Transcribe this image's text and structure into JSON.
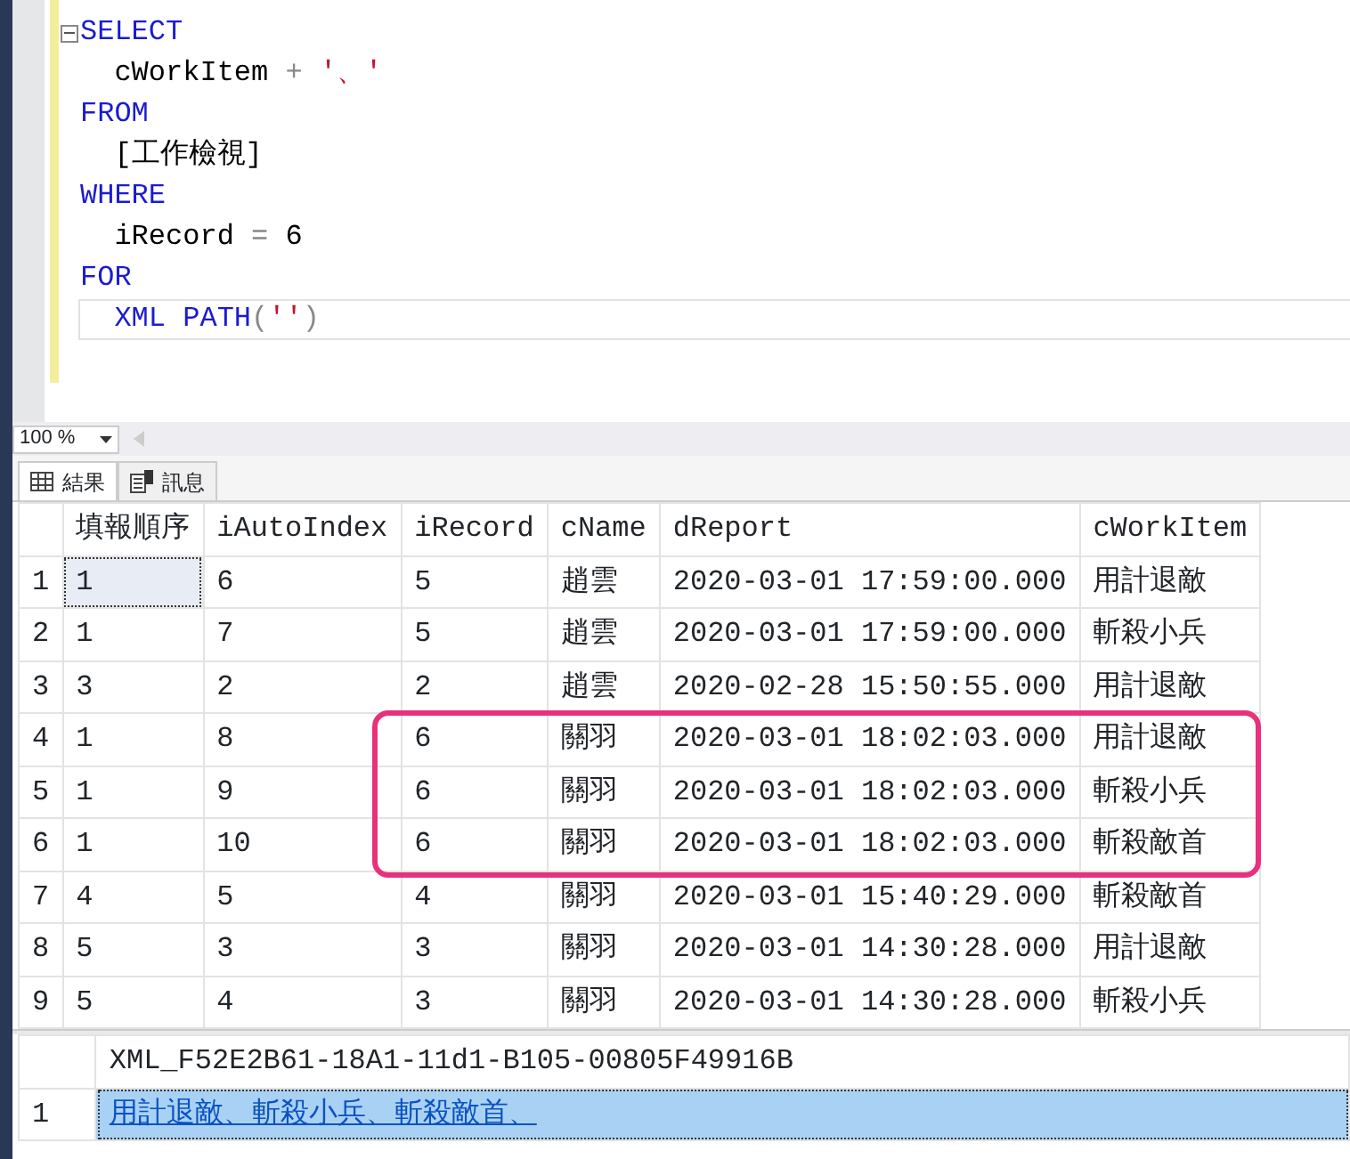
{
  "editor": {
    "lines": [
      {
        "collapsible": true,
        "current": false,
        "tokens": [
          {
            "kind": "keyword",
            "text": "SELECT"
          }
        ]
      },
      {
        "collapsible": false,
        "current": false,
        "tokens": [
          {
            "kind": "ident",
            "text": "  cWorkItem"
          },
          {
            "kind": "operator",
            "text": " + "
          },
          {
            "kind": "string",
            "text": "'、'"
          }
        ]
      },
      {
        "collapsible": false,
        "current": false,
        "tokens": [
          {
            "kind": "keyword",
            "text": "FROM"
          }
        ]
      },
      {
        "collapsible": false,
        "current": false,
        "tokens": [
          {
            "kind": "ident",
            "text": "  [工作檢視]"
          }
        ]
      },
      {
        "collapsible": false,
        "current": false,
        "tokens": [
          {
            "kind": "keyword",
            "text": "WHERE"
          }
        ]
      },
      {
        "collapsible": false,
        "current": false,
        "tokens": [
          {
            "kind": "ident",
            "text": "  iRecord"
          },
          {
            "kind": "operator",
            "text": " = "
          },
          {
            "kind": "ident",
            "text": "6"
          }
        ]
      },
      {
        "collapsible": false,
        "current": false,
        "tokens": [
          {
            "kind": "keyword",
            "text": "FOR"
          }
        ]
      },
      {
        "collapsible": false,
        "current": true,
        "tokens": [
          {
            "kind": "keyword",
            "text": "  XML PATH"
          },
          {
            "kind": "operator",
            "text": "("
          },
          {
            "kind": "string",
            "text": "''"
          },
          {
            "kind": "operator",
            "text": ")"
          }
        ]
      }
    ]
  },
  "zoom": "100 %",
  "tabs": [
    {
      "label": "結果",
      "selected": true
    },
    {
      "label": "訊息",
      "selected": false
    }
  ],
  "grid": {
    "columns": [
      "填報順序",
      "iAutoIndex",
      "iRecord",
      "cName",
      "dReport",
      "cWorkItem"
    ],
    "rows": [
      {
        "number": "1",
        "focused": true,
        "highlighted": false,
        "cells": [
          "1",
          "6",
          "5",
          "趙雲",
          "2020-03-01 17:59:00.000",
          "用計退敵"
        ]
      },
      {
        "number": "2",
        "focused": false,
        "highlighted": false,
        "cells": [
          "1",
          "7",
          "5",
          "趙雲",
          "2020-03-01 17:59:00.000",
          "斬殺小兵"
        ]
      },
      {
        "number": "3",
        "focused": false,
        "highlighted": false,
        "cells": [
          "3",
          "2",
          "2",
          "趙雲",
          "2020-02-28 15:50:55.000",
          "用計退敵"
        ]
      },
      {
        "number": "4",
        "focused": false,
        "highlighted": true,
        "cells": [
          "1",
          "8",
          "6",
          "關羽",
          "2020-03-01 18:02:03.000",
          "用計退敵"
        ]
      },
      {
        "number": "5",
        "focused": false,
        "highlighted": true,
        "cells": [
          "1",
          "9",
          "6",
          "關羽",
          "2020-03-01 18:02:03.000",
          "斬殺小兵"
        ]
      },
      {
        "number": "6",
        "focused": false,
        "highlighted": true,
        "cells": [
          "1",
          "10",
          "6",
          "關羽",
          "2020-03-01 18:02:03.000",
          "斬殺敵首"
        ]
      },
      {
        "number": "7",
        "focused": false,
        "highlighted": false,
        "cells": [
          "4",
          "5",
          "4",
          "關羽",
          "2020-03-01 15:40:29.000",
          "斬殺敵首"
        ]
      },
      {
        "number": "8",
        "focused": false,
        "highlighted": false,
        "cells": [
          "5",
          "3",
          "3",
          "關羽",
          "2020-03-01 14:30:28.000",
          "用計退敵"
        ]
      },
      {
        "number": "9",
        "focused": false,
        "highlighted": false,
        "cells": [
          "5",
          "4",
          "3",
          "關羽",
          "2020-03-01 14:30:28.000",
          "斬殺小兵"
        ]
      }
    ]
  },
  "xml_grid": {
    "column": "XML_F52E2B61-18A1-11d1-B105-00805F49916B",
    "rows": [
      {
        "number": "1",
        "selected": true,
        "link": "用計退敵、斬殺小兵、斬殺敵首、"
      }
    ]
  }
}
